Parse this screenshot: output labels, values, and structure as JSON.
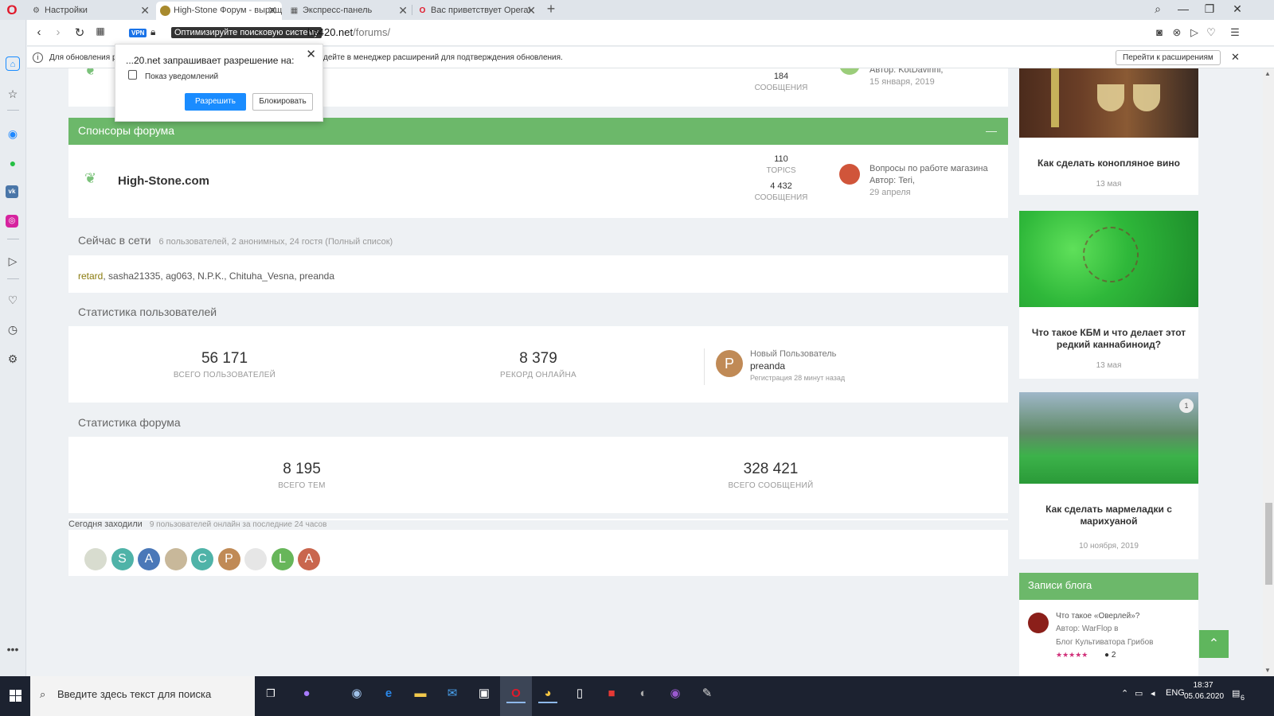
{
  "tabs": [
    {
      "label": "Настройки",
      "icon": "gear-icon"
    },
    {
      "label": "High-Stone Форум - выращ",
      "icon": "site-favicon"
    },
    {
      "label": "Экспресс-панель",
      "icon": "grid-icon"
    },
    {
      "label": "Вас приветствует Opera!",
      "icon": "opera-icon"
    }
  ],
  "address": {
    "vpn": "VPN",
    "seo_tooltip": "Оптимизируйте поисковую систему",
    "host": "hs420.net",
    "path": "/forums/"
  },
  "infobar": {
    "text_a": "Для обновления ра",
    "text_b": "дейте в менеджер расширений для подтверждения обновления.",
    "button": "Перейти к расширениям"
  },
  "popup": {
    "title": "...20.net запрашивает разрешение на:",
    "permission": "Показ уведомлений",
    "allow": "Разрешить",
    "block": "Блокировать"
  },
  "top_forum": {
    "count": "184",
    "count_label": "СООБЩЕНИЯ",
    "author": "Автор: KotDavinni,",
    "date": "15 января, 2019"
  },
  "sponsors": {
    "header": "Спонсоры форума",
    "forum_name": "High-Stone.com",
    "topics": "110",
    "topics_label": "TOPICS",
    "posts": "4 432",
    "posts_label": "СООБЩЕНИЯ",
    "last_title": "Вопросы по работе магазина",
    "last_author": "Автор: Teri,",
    "last_date": "29 апреля"
  },
  "online": {
    "title": "Сейчас в сети",
    "summary": "6 пользователей, 2 анонимных, 24 гостя (Полный список)",
    "first_user": "retard",
    "other_users": ", sasha21335, ag063, N.P.K., Chituha_Vesna, preanda"
  },
  "user_stats": {
    "title": "Статистика пользователей",
    "total": "56 171",
    "total_label": "ВСЕГО ПОЛЬЗОВАТЕЛЕЙ",
    "record": "8 379",
    "record_label": "РЕКОРД ОНЛАЙНА",
    "new_label": "Новый Пользователь",
    "new_user": "preanda",
    "new_initial": "P",
    "registered": "Регистрация 28 минут назад"
  },
  "forum_stats": {
    "title": "Статистика форума",
    "topics": "8 195",
    "topics_label": "ВСЕГО ТЕМ",
    "posts": "328 421",
    "posts_label": "ВСЕГО СООБЩЕНИЙ"
  },
  "today": {
    "title": "Сегодня заходили",
    "summary": "9 пользователей онлайн за последние 24 часов",
    "avatars": [
      {
        "letter": "",
        "color": "#d8dccf"
      },
      {
        "letter": "S",
        "color": "#4fb3a8"
      },
      {
        "letter": "A",
        "color": "#4a78b8"
      },
      {
        "letter": "",
        "color": "#c8b89a"
      },
      {
        "letter": "C",
        "color": "#4fb3a8"
      },
      {
        "letter": "P",
        "color": "#c08a56"
      },
      {
        "letter": "",
        "color": "#e6e6e6"
      },
      {
        "letter": "L",
        "color": "#67b65a"
      },
      {
        "letter": "A",
        "color": "#c9664e"
      }
    ]
  },
  "right_col": {
    "articles": [
      {
        "title": "Как сделать конопляное вино",
        "date": "13 мая"
      },
      {
        "title": "Что такое КБМ и что делает этот редкий каннабиноид?",
        "date": "13 мая"
      },
      {
        "title": "Как сделать мармеладки с марихуаной",
        "date": "10 ноября, 2019",
        "badge": "1"
      }
    ],
    "blog_header": "Записи блога",
    "blog_entry": {
      "title": "Что такое «Оверлей»?",
      "author": "Автор: WarFlop в",
      "blog": "Блог Культиватора Грибов",
      "stars": "★★★★★",
      "comments": "2"
    }
  },
  "taskbar": {
    "search_placeholder": "Введите здесь текст для поиска",
    "lang": "ENG",
    "time": "18:37",
    "date": "05.06.2020",
    "notifications": "6"
  }
}
